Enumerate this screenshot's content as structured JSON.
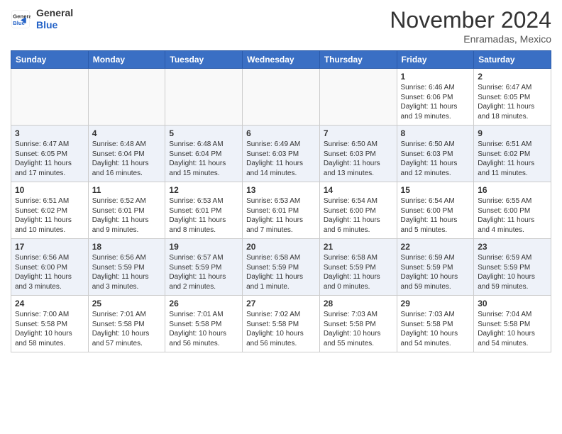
{
  "header": {
    "logo": {
      "general": "General",
      "blue": "Blue"
    },
    "title": "November 2024",
    "subtitle": "Enramadas, Mexico"
  },
  "weekdays": [
    "Sunday",
    "Monday",
    "Tuesday",
    "Wednesday",
    "Thursday",
    "Friday",
    "Saturday"
  ],
  "weeks": [
    [
      {
        "day": "",
        "sunrise": "",
        "sunset": "",
        "daylight": "",
        "empty": true
      },
      {
        "day": "",
        "sunrise": "",
        "sunset": "",
        "daylight": "",
        "empty": true
      },
      {
        "day": "",
        "sunrise": "",
        "sunset": "",
        "daylight": "",
        "empty": true
      },
      {
        "day": "",
        "sunrise": "",
        "sunset": "",
        "daylight": "",
        "empty": true
      },
      {
        "day": "",
        "sunrise": "",
        "sunset": "",
        "daylight": "",
        "empty": true
      },
      {
        "day": "1",
        "sunrise": "Sunrise: 6:46 AM",
        "sunset": "Sunset: 6:06 PM",
        "daylight": "Daylight: 11 hours and 19 minutes.",
        "empty": false
      },
      {
        "day": "2",
        "sunrise": "Sunrise: 6:47 AM",
        "sunset": "Sunset: 6:05 PM",
        "daylight": "Daylight: 11 hours and 18 minutes.",
        "empty": false
      }
    ],
    [
      {
        "day": "3",
        "sunrise": "Sunrise: 6:47 AM",
        "sunset": "Sunset: 6:05 PM",
        "daylight": "Daylight: 11 hours and 17 minutes.",
        "empty": false
      },
      {
        "day": "4",
        "sunrise": "Sunrise: 6:48 AM",
        "sunset": "Sunset: 6:04 PM",
        "daylight": "Daylight: 11 hours and 16 minutes.",
        "empty": false
      },
      {
        "day": "5",
        "sunrise": "Sunrise: 6:48 AM",
        "sunset": "Sunset: 6:04 PM",
        "daylight": "Daylight: 11 hours and 15 minutes.",
        "empty": false
      },
      {
        "day": "6",
        "sunrise": "Sunrise: 6:49 AM",
        "sunset": "Sunset: 6:03 PM",
        "daylight": "Daylight: 11 hours and 14 minutes.",
        "empty": false
      },
      {
        "day": "7",
        "sunrise": "Sunrise: 6:50 AM",
        "sunset": "Sunset: 6:03 PM",
        "daylight": "Daylight: 11 hours and 13 minutes.",
        "empty": false
      },
      {
        "day": "8",
        "sunrise": "Sunrise: 6:50 AM",
        "sunset": "Sunset: 6:03 PM",
        "daylight": "Daylight: 11 hours and 12 minutes.",
        "empty": false
      },
      {
        "day": "9",
        "sunrise": "Sunrise: 6:51 AM",
        "sunset": "Sunset: 6:02 PM",
        "daylight": "Daylight: 11 hours and 11 minutes.",
        "empty": false
      }
    ],
    [
      {
        "day": "10",
        "sunrise": "Sunrise: 6:51 AM",
        "sunset": "Sunset: 6:02 PM",
        "daylight": "Daylight: 11 hours and 10 minutes.",
        "empty": false
      },
      {
        "day": "11",
        "sunrise": "Sunrise: 6:52 AM",
        "sunset": "Sunset: 6:01 PM",
        "daylight": "Daylight: 11 hours and 9 minutes.",
        "empty": false
      },
      {
        "day": "12",
        "sunrise": "Sunrise: 6:53 AM",
        "sunset": "Sunset: 6:01 PM",
        "daylight": "Daylight: 11 hours and 8 minutes.",
        "empty": false
      },
      {
        "day": "13",
        "sunrise": "Sunrise: 6:53 AM",
        "sunset": "Sunset: 6:01 PM",
        "daylight": "Daylight: 11 hours and 7 minutes.",
        "empty": false
      },
      {
        "day": "14",
        "sunrise": "Sunrise: 6:54 AM",
        "sunset": "Sunset: 6:00 PM",
        "daylight": "Daylight: 11 hours and 6 minutes.",
        "empty": false
      },
      {
        "day": "15",
        "sunrise": "Sunrise: 6:54 AM",
        "sunset": "Sunset: 6:00 PM",
        "daylight": "Daylight: 11 hours and 5 minutes.",
        "empty": false
      },
      {
        "day": "16",
        "sunrise": "Sunrise: 6:55 AM",
        "sunset": "Sunset: 6:00 PM",
        "daylight": "Daylight: 11 hours and 4 minutes.",
        "empty": false
      }
    ],
    [
      {
        "day": "17",
        "sunrise": "Sunrise: 6:56 AM",
        "sunset": "Sunset: 6:00 PM",
        "daylight": "Daylight: 11 hours and 3 minutes.",
        "empty": false
      },
      {
        "day": "18",
        "sunrise": "Sunrise: 6:56 AM",
        "sunset": "Sunset: 5:59 PM",
        "daylight": "Daylight: 11 hours and 3 minutes.",
        "empty": false
      },
      {
        "day": "19",
        "sunrise": "Sunrise: 6:57 AM",
        "sunset": "Sunset: 5:59 PM",
        "daylight": "Daylight: 11 hours and 2 minutes.",
        "empty": false
      },
      {
        "day": "20",
        "sunrise": "Sunrise: 6:58 AM",
        "sunset": "Sunset: 5:59 PM",
        "daylight": "Daylight: 11 hours and 1 minute.",
        "empty": false
      },
      {
        "day": "21",
        "sunrise": "Sunrise: 6:58 AM",
        "sunset": "Sunset: 5:59 PM",
        "daylight": "Daylight: 11 hours and 0 minutes.",
        "empty": false
      },
      {
        "day": "22",
        "sunrise": "Sunrise: 6:59 AM",
        "sunset": "Sunset: 5:59 PM",
        "daylight": "Daylight: 10 hours and 59 minutes.",
        "empty": false
      },
      {
        "day": "23",
        "sunrise": "Sunrise: 6:59 AM",
        "sunset": "Sunset: 5:59 PM",
        "daylight": "Daylight: 10 hours and 59 minutes.",
        "empty": false
      }
    ],
    [
      {
        "day": "24",
        "sunrise": "Sunrise: 7:00 AM",
        "sunset": "Sunset: 5:58 PM",
        "daylight": "Daylight: 10 hours and 58 minutes.",
        "empty": false
      },
      {
        "day": "25",
        "sunrise": "Sunrise: 7:01 AM",
        "sunset": "Sunset: 5:58 PM",
        "daylight": "Daylight: 10 hours and 57 minutes.",
        "empty": false
      },
      {
        "day": "26",
        "sunrise": "Sunrise: 7:01 AM",
        "sunset": "Sunset: 5:58 PM",
        "daylight": "Daylight: 10 hours and 56 minutes.",
        "empty": false
      },
      {
        "day": "27",
        "sunrise": "Sunrise: 7:02 AM",
        "sunset": "Sunset: 5:58 PM",
        "daylight": "Daylight: 10 hours and 56 minutes.",
        "empty": false
      },
      {
        "day": "28",
        "sunrise": "Sunrise: 7:03 AM",
        "sunset": "Sunset: 5:58 PM",
        "daylight": "Daylight: 10 hours and 55 minutes.",
        "empty": false
      },
      {
        "day": "29",
        "sunrise": "Sunrise: 7:03 AM",
        "sunset": "Sunset: 5:58 PM",
        "daylight": "Daylight: 10 hours and 54 minutes.",
        "empty": false
      },
      {
        "day": "30",
        "sunrise": "Sunrise: 7:04 AM",
        "sunset": "Sunset: 5:58 PM",
        "daylight": "Daylight: 10 hours and 54 minutes.",
        "empty": false
      }
    ]
  ]
}
